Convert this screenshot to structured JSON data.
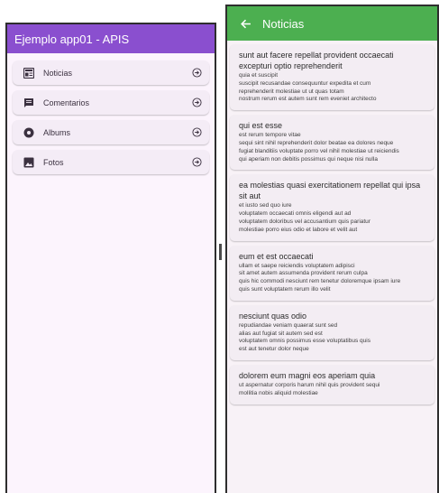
{
  "left_window": {
    "appbar_title": "Ejemplo app01 - APIS",
    "appbar_color": "#8a4fcf",
    "items": [
      {
        "label": "Noticias",
        "icon": "newspaper-icon"
      },
      {
        "label": "Comentarios",
        "icon": "comment-icon"
      },
      {
        "label": "Albums",
        "icon": "album-icon"
      },
      {
        "label": "Fotos",
        "icon": "image-icon"
      }
    ]
  },
  "right_window": {
    "appbar_title": "Noticias",
    "appbar_color": "#4caf50",
    "posts": [
      {
        "title": "sunt aut facere repellat provident occaecati excepturi optio reprehenderit",
        "body": "quia et suscipit\nsuscipit recusandae consequuntur expedita et cum\nreprehenderit molestiae ut ut quas totam\nnostrum rerum est autem sunt rem eveniet architecto"
      },
      {
        "title": "qui est esse",
        "body": "est rerum tempore vitae\nsequi sint nihil reprehenderit dolor beatae ea dolores neque\nfugiat blanditiis voluptate porro vel nihil molestiae ut reiciendis\nqui aperiam non debitis possimus qui neque nisi nulla"
      },
      {
        "title": "ea molestias quasi exercitationem repellat qui ipsa sit aut",
        "body": "et iusto sed quo iure\nvoluptatem occaecati omnis eligendi aut ad\nvoluptatem doloribus vel accusantium quis pariatur\nmolestiae porro eius odio et labore et velit aut"
      },
      {
        "title": "eum et est occaecati",
        "body": "ullam et saepe reiciendis voluptatem adipisci\nsit amet autem assumenda provident rerum culpa\nquis hic commodi nesciunt rem tenetur doloremque ipsam iure\nquis sunt voluptatem rerum illo velit"
      },
      {
        "title": "nesciunt quas odio",
        "body": "repudiandae veniam quaerat sunt sed\nalias aut fugiat sit autem sed est\nvoluptatem omnis possimus esse voluptatibus quis\nest aut tenetur dolor neque"
      },
      {
        "title": "dolorem eum magni eos aperiam quia",
        "body": "ut aspernatur corporis harum nihil quis provident sequi\nmollitia nobis aliquid molestiae"
      }
    ]
  }
}
